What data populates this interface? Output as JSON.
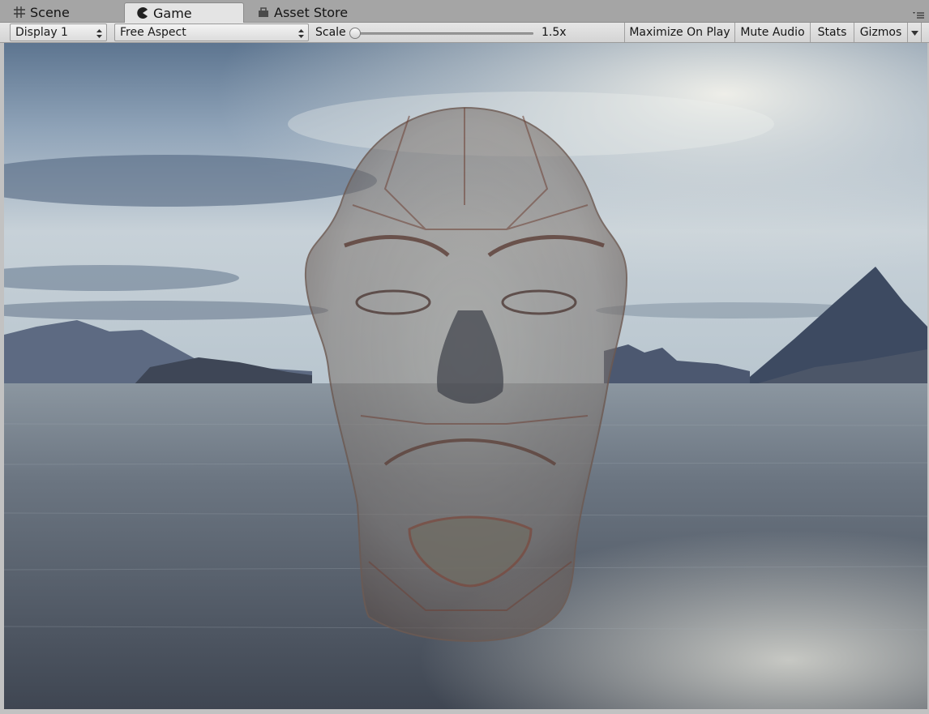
{
  "tabs": [
    {
      "label": "Scene",
      "icon": "grid-icon",
      "active": false
    },
    {
      "label": "Game",
      "icon": "pacman-icon",
      "active": true
    },
    {
      "label": "Asset Store",
      "icon": "store-icon",
      "active": false
    }
  ],
  "toolbar": {
    "display_select": "Display 1",
    "aspect_select": "Free Aspect",
    "scale_label": "Scale",
    "scale_value": "1.5x",
    "scale_fraction": 0.0,
    "maximize_label": "Maximize On Play",
    "mute_label": "Mute Audio",
    "stats_label": "Stats",
    "gizmos_label": "Gizmos"
  },
  "colors": {
    "active_tab": "#e4e4e4",
    "tab_strip": "#a5a5a5",
    "toolbar": "#dcdcdc"
  }
}
